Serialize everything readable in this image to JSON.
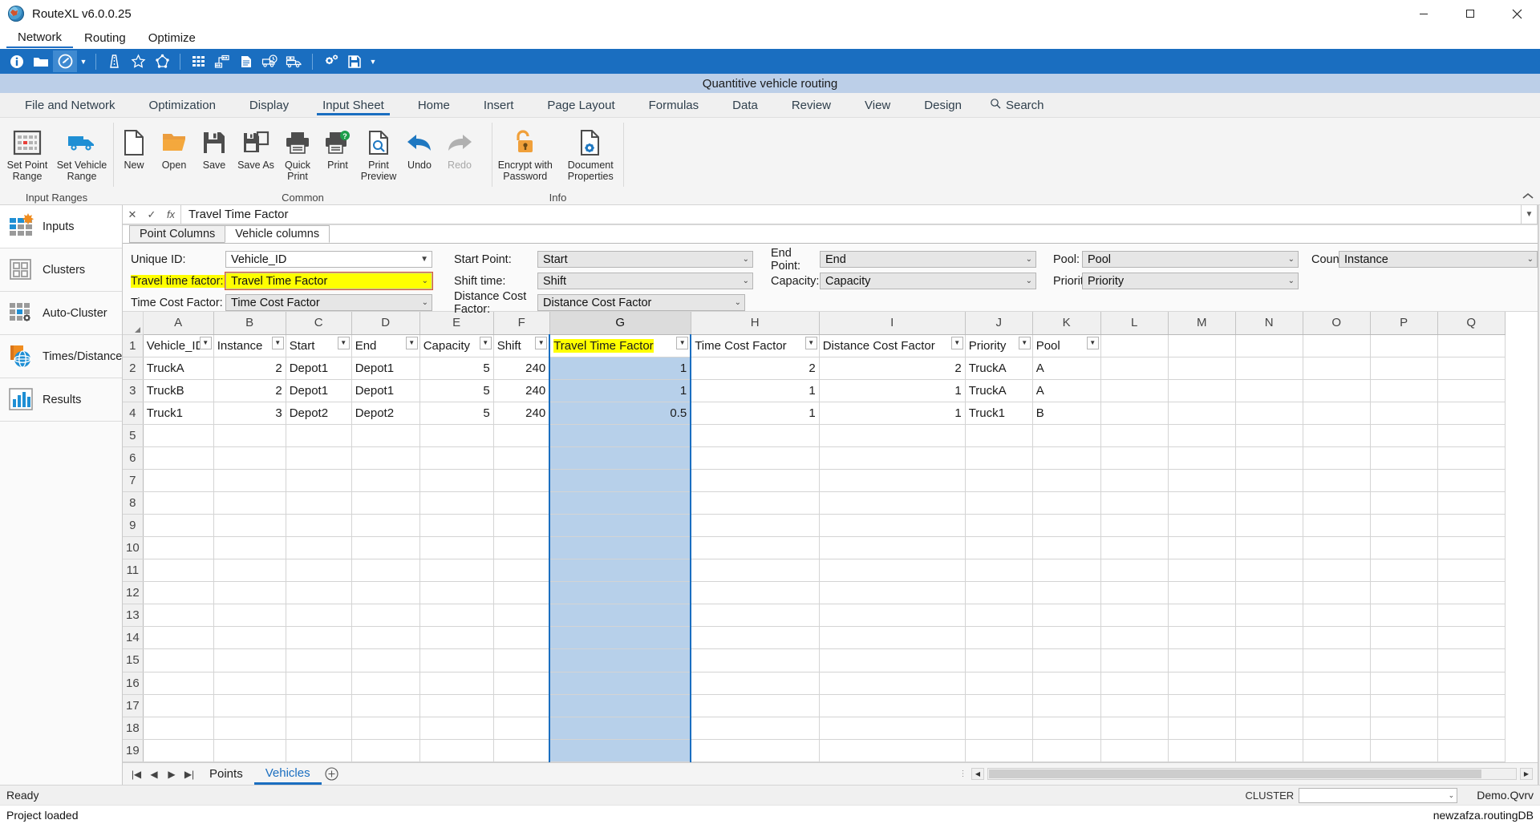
{
  "window": {
    "title": "RouteXL v6.0.0.25",
    "app_icon": "globe-icon",
    "minimize": "minimize-button",
    "maximize": "maximize-button",
    "close": "close-button"
  },
  "menubar": {
    "items": [
      "Network",
      "Routing",
      "Optimize"
    ],
    "active": "Network"
  },
  "toolbar": {
    "buttons": [
      {
        "name": "info-icon",
        "glyph": "i"
      },
      {
        "name": "folder-open-icon",
        "glyph": "folder"
      },
      {
        "name": "compass-icon",
        "glyph": "compass",
        "selected": true
      },
      {
        "name": "chevron-down-icon",
        "glyph": "caret"
      },
      {
        "name": "road-icon",
        "glyph": "road"
      },
      {
        "name": "star-icon",
        "glyph": "star"
      },
      {
        "name": "polygon-icon",
        "glyph": "polygon"
      },
      {
        "name": "grid-dots-icon",
        "glyph": "grid"
      },
      {
        "name": "cluster-icon",
        "glyph": "cluster"
      },
      {
        "name": "document-icon",
        "glyph": "doc"
      },
      {
        "name": "truck-clock-icon",
        "glyph": "truckclock"
      },
      {
        "name": "truck-load-icon",
        "glyph": "truckload"
      },
      {
        "name": "settings-gears-icon",
        "glyph": "gears"
      },
      {
        "name": "save-disk-icon",
        "glyph": "save"
      },
      {
        "name": "chevron-down-icon-2",
        "glyph": "caret"
      }
    ]
  },
  "document_title": "Quantitive vehicle routing",
  "ribbon_tabs": {
    "items": [
      "File and Network",
      "Optimization",
      "Display",
      "Input Sheet",
      "Home",
      "Insert",
      "Page Layout",
      "Formulas",
      "Data",
      "Review",
      "View",
      "Design"
    ],
    "active": "Input Sheet",
    "search_label": "Search",
    "search_icon": "search-icon"
  },
  "ribbon": {
    "groups": [
      {
        "label": "Input Ranges",
        "buttons": [
          {
            "label": "Set Point Range",
            "icon": "point-range-icon",
            "disabled": false
          },
          {
            "label": "Set Vehicle Range",
            "icon": "vehicle-range-icon",
            "disabled": false
          }
        ]
      },
      {
        "label": "Common",
        "buttons": [
          {
            "label": "New",
            "icon": "new-document-icon",
            "disabled": false
          },
          {
            "label": "Open",
            "icon": "open-folder-icon",
            "disabled": false
          },
          {
            "label": "Save",
            "icon": "save-disk-icon",
            "disabled": false
          },
          {
            "label": "Save As",
            "icon": "save-as-icon",
            "disabled": false
          },
          {
            "label": "Quick Print",
            "icon": "quick-print-icon",
            "disabled": false
          },
          {
            "label": "Print",
            "icon": "print-dialog-icon",
            "disabled": false
          },
          {
            "label": "Print Preview",
            "icon": "print-preview-icon",
            "disabled": false
          },
          {
            "label": "Undo",
            "icon": "undo-arrow-icon",
            "disabled": false
          },
          {
            "label": "Redo",
            "icon": "redo-arrow-icon",
            "disabled": true
          }
        ]
      },
      {
        "label": "Info",
        "buttons": [
          {
            "label": "Encrypt with Password",
            "icon": "lock-icon",
            "disabled": false
          },
          {
            "label": "Document Properties",
            "icon": "document-properties-icon",
            "disabled": false
          }
        ]
      }
    ],
    "collapse_icon": "collapse-ribbon-icon"
  },
  "sidebar": {
    "items": [
      {
        "label": "Inputs",
        "icon": "inputs-grid-icon",
        "active": true
      },
      {
        "label": "Clusters",
        "icon": "clusters-icon",
        "active": false
      },
      {
        "label": "Auto-Cluster",
        "icon": "auto-cluster-icon",
        "active": false
      },
      {
        "label": "Times/Distances",
        "icon": "times-distances-icon",
        "active": false
      },
      {
        "label": "Results",
        "icon": "results-chart-icon",
        "active": false
      }
    ]
  },
  "formula_bar": {
    "cancel_icon": "cancel-icon",
    "confirm_icon": "confirm-icon",
    "function_icon": "fx-icon",
    "value": "Travel Time Factor",
    "expand_icon": "expand-formula-bar-icon"
  },
  "column_tabs": {
    "items": [
      "Point Columns",
      "Vehicle columns"
    ],
    "active": "Vehicle columns"
  },
  "field_form": {
    "rows": [
      [
        {
          "label": "Unique ID:",
          "value": "Vehicle_ID",
          "style": "white",
          "label_hl": false,
          "value_hl": false,
          "name": "unique-id"
        },
        {
          "label": "Start Point:",
          "value": "Start",
          "style": "plain",
          "label_hl": false,
          "value_hl": false,
          "name": "start-point"
        },
        {
          "label": "End Point:",
          "value": "End",
          "style": "plain",
          "label_hl": false,
          "value_hl": false,
          "name": "end-point"
        },
        {
          "label": "Pool:",
          "value": "Pool",
          "style": "plain",
          "label_hl": false,
          "value_hl": false,
          "name": "pool"
        },
        {
          "label": "Count:",
          "value": "Instance",
          "style": "plain",
          "label_hl": false,
          "value_hl": false,
          "name": "count"
        }
      ],
      [
        {
          "label": "Travel time factor:",
          "value": "Travel Time Factor",
          "style": "plain",
          "label_hl": true,
          "value_hl": true,
          "name": "travel-time-factor"
        },
        {
          "label": "Shift time:",
          "value": "Shift",
          "style": "plain",
          "label_hl": false,
          "value_hl": false,
          "name": "shift-time"
        },
        {
          "label": "Capacity:",
          "value": "Capacity",
          "style": "plain",
          "label_hl": false,
          "value_hl": false,
          "name": "capacity"
        },
        {
          "label": "Priority",
          "value": "Priority",
          "style": "plain",
          "label_hl": false,
          "value_hl": false,
          "name": "priority"
        }
      ],
      [
        {
          "label": "Time Cost Factor:",
          "value": "Time Cost Factor",
          "style": "plain",
          "label_hl": false,
          "value_hl": false,
          "name": "time-cost-factor"
        },
        {
          "label": "Distance Cost Factor:",
          "value": "Distance Cost Factor",
          "style": "plain",
          "label_hl": false,
          "value_hl": false,
          "name": "distance-cost-factor"
        }
      ]
    ]
  },
  "grid": {
    "column_letters": [
      "A",
      "B",
      "C",
      "D",
      "E",
      "F",
      "G",
      "H",
      "I",
      "J",
      "K",
      "L",
      "M",
      "N",
      "O",
      "P",
      "Q"
    ],
    "selected_column": "G",
    "headers": [
      "Vehicle_ID",
      "Instance",
      "Start",
      "End",
      "Capacity",
      "Shift",
      "Travel Time Factor",
      "Time Cost Factor",
      "Distance Cost Factor",
      "Priority",
      "Pool"
    ],
    "highlighted_header": "Travel Time Factor",
    "header_row_number": "1",
    "rows": [
      {
        "num": "2",
        "cells": [
          "TruckA",
          "2",
          "Depot1",
          "Depot1",
          "5",
          "240",
          "1",
          "2",
          "2",
          "TruckA",
          "A"
        ]
      },
      {
        "num": "3",
        "cells": [
          "TruckB",
          "2",
          "Depot1",
          "Depot1",
          "5",
          "240",
          "1",
          "1",
          "1",
          "TruckA",
          "A"
        ]
      },
      {
        "num": "4",
        "cells": [
          "Truck1",
          "3",
          "Depot2",
          "Depot2",
          "5",
          "240",
          "0.5",
          "1",
          "1",
          "Truck1",
          "B"
        ]
      }
    ],
    "empty_row_numbers": [
      "5",
      "6",
      "7",
      "8",
      "9",
      "10",
      "11",
      "12",
      "13",
      "14",
      "15",
      "16",
      "17",
      "18",
      "19"
    ],
    "numeric_columns": [
      1,
      4,
      5,
      6,
      7,
      8
    ],
    "selection_color": "#b7d0ea",
    "selection_border_color": "#1a6ec0"
  },
  "sheet_tabs": {
    "nav": [
      "first-sheet-icon",
      "prev-sheet-icon",
      "next-sheet-icon",
      "last-sheet-icon"
    ],
    "items": [
      "Points",
      "Vehicles"
    ],
    "active": "Vehicles",
    "add_label": "+",
    "add_icon": "add-sheet-icon"
  },
  "status": {
    "left": "Ready",
    "cluster_label": "CLUSTER",
    "cluster_value": "",
    "qvrv": "Demo.Qvrv",
    "message": "Project loaded",
    "db": "newzafza.routingDB",
    "ellipsis": "..."
  }
}
